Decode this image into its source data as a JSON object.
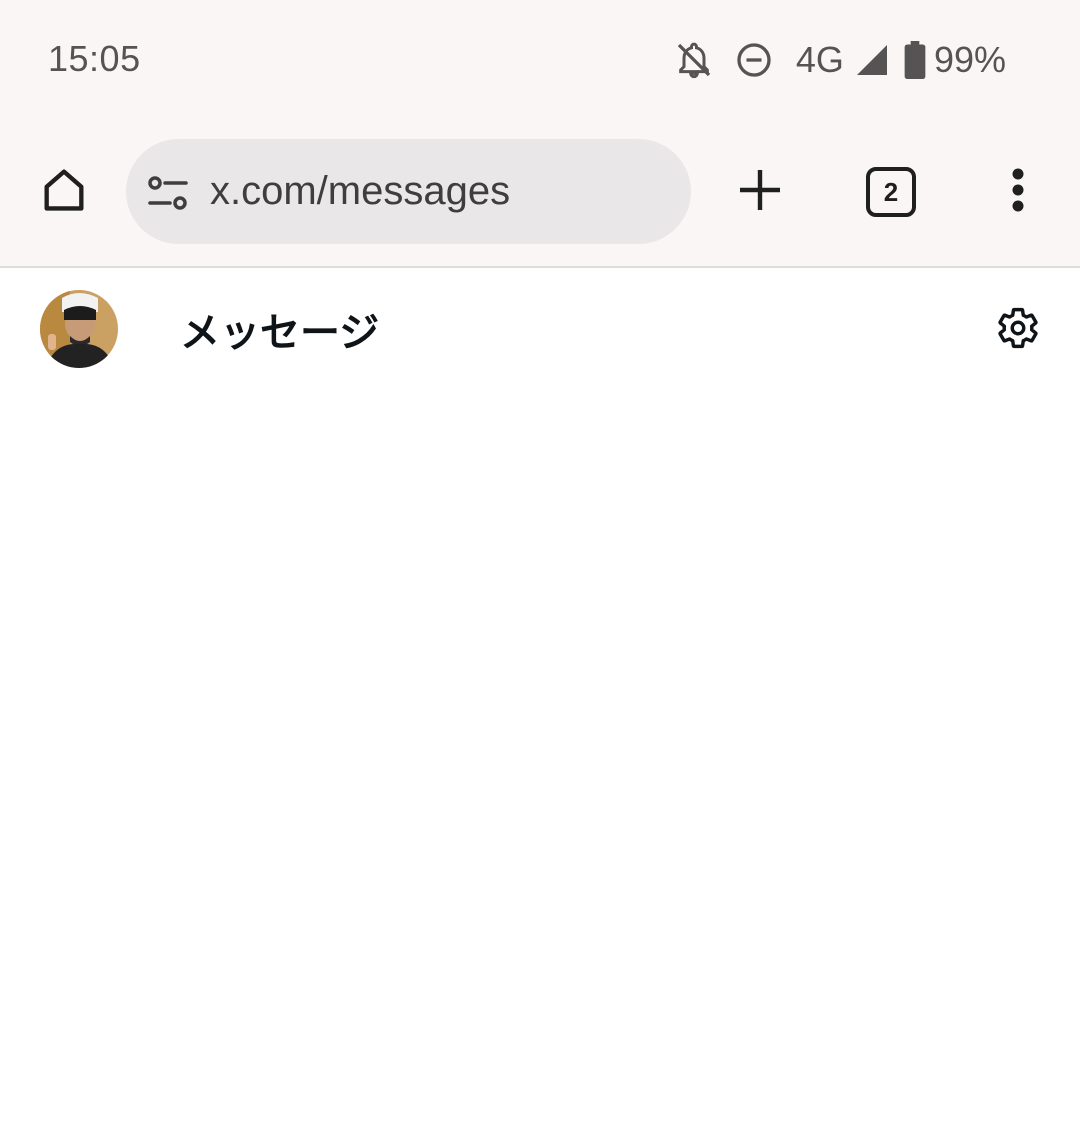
{
  "status_bar": {
    "time": "15:05",
    "network": "4G",
    "battery": "99%",
    "icons": [
      "notifications-off-icon",
      "do-not-disturb-icon",
      "signal-icon",
      "battery-icon"
    ]
  },
  "browser": {
    "url": "x.com/messages",
    "tab_count": "2",
    "icons": [
      "home-icon",
      "site-settings-icon",
      "new-tab-icon",
      "tab-switcher-icon",
      "more-vert-icon"
    ]
  },
  "page": {
    "title": "メッセージ",
    "icons": [
      "avatar",
      "settings-gear-icon"
    ]
  },
  "colors": {
    "chrome_bg": "#faf6f6",
    "omnibox_bg": "#e9e7e8",
    "page_bg": "#ffffff",
    "text_primary": "#0f1419"
  }
}
